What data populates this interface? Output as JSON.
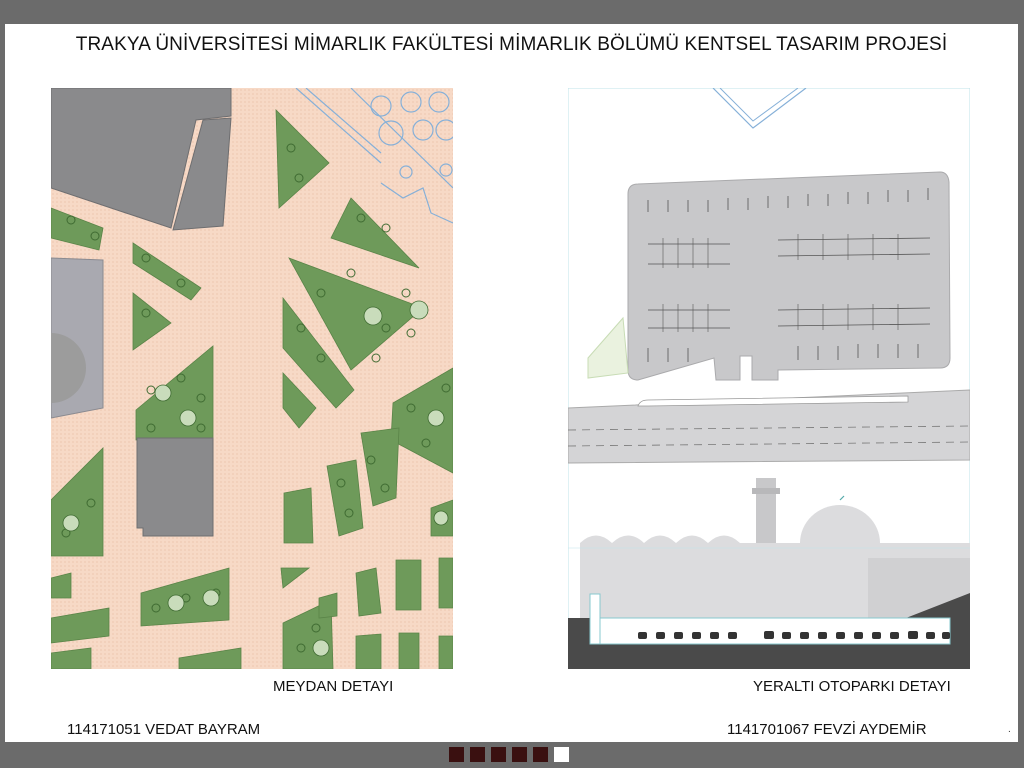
{
  "slide": {
    "title": "TRAKYA ÜNİVERSİTESİ MİMARLIK FAKÜLTESİ MİMARLIK BÖLÜMÜ KENTSEL TASARIM PROJESİ",
    "left_caption": "MEYDAN DETAYI",
    "right_caption": "YERALTI OTOPARKI DETAYI",
    "student_left": "114171051 VEDAT BAYRAM",
    "student_right": "1141701067 FEVZİ AYDEMİR",
    "corner_mark": "."
  },
  "navigation": {
    "slides": [
      {
        "active": false
      },
      {
        "active": false
      },
      {
        "active": false
      },
      {
        "active": false
      },
      {
        "active": false
      },
      {
        "active": true
      }
    ]
  },
  "colors": {
    "plaza": "#f7d9c6",
    "green": "#6e9a5a",
    "building": "#8a8a8c",
    "parking": "#c8c8ca",
    "road": "#d4d4d6",
    "section_dark": "#4a4a4a",
    "nav_inactive": "#3a1010",
    "nav_active": "#ffffff"
  }
}
